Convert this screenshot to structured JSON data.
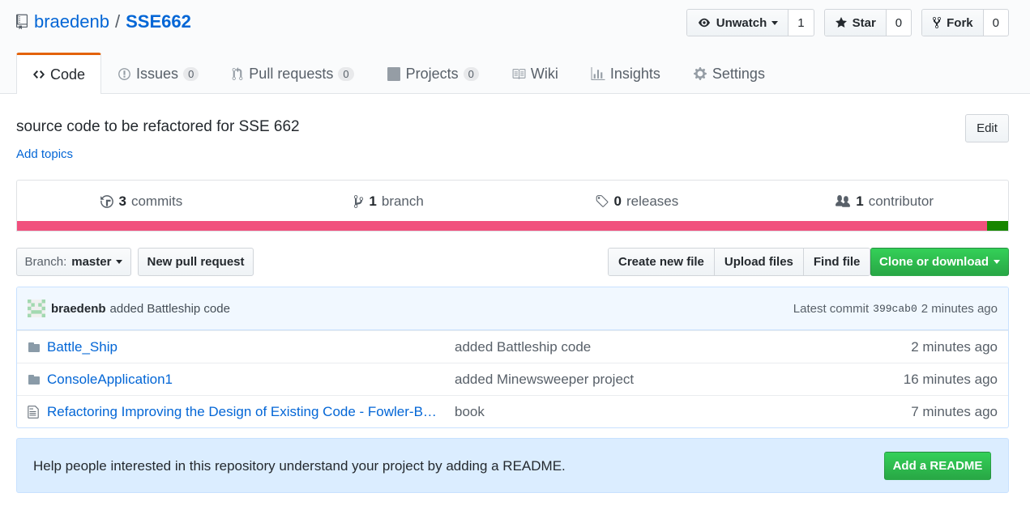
{
  "repo": {
    "owner": "braedenb",
    "separator": "/",
    "name": "SSE662"
  },
  "actions": {
    "watch": {
      "label": "Unwatch",
      "count": "1"
    },
    "star": {
      "label": "Star",
      "count": "0"
    },
    "fork": {
      "label": "Fork",
      "count": "0"
    }
  },
  "tabs": [
    {
      "label": "Code",
      "icon": "code-icon"
    },
    {
      "label": "Issues",
      "counter": "0",
      "icon": "issue-icon"
    },
    {
      "label": "Pull requests",
      "counter": "0",
      "icon": "pull-request-icon"
    },
    {
      "label": "Projects",
      "counter": "0",
      "icon": "project-icon"
    },
    {
      "label": "Wiki",
      "icon": "book-icon"
    },
    {
      "label": "Insights",
      "icon": "graph-icon"
    },
    {
      "label": "Settings",
      "icon": "gear-icon"
    }
  ],
  "description": "source code to be refactored for SSE 662",
  "add_topics": "Add topics",
  "edit_label": "Edit",
  "summary": {
    "commits": {
      "num": "3",
      "label": "commits"
    },
    "branches": {
      "num": "1",
      "label": "branch"
    },
    "releases": {
      "num": "0",
      "label": "releases"
    },
    "contributors": {
      "num": "1",
      "label": "contributor"
    }
  },
  "language_bar": [
    {
      "color": "#f1507d",
      "fraction": 0.979
    },
    {
      "color": "#178600",
      "fraction": 0.021
    }
  ],
  "branch": {
    "label": "Branch:",
    "value": "master"
  },
  "new_pr_label": "New pull request",
  "file_buttons": [
    "Create new file",
    "Upload files",
    "Find file"
  ],
  "clone_label": "Clone or download",
  "commit_tease": {
    "author": "braedenb",
    "message": "added Battleship code",
    "latest_label": "Latest commit",
    "sha": "399cab0",
    "age": "2 minutes ago"
  },
  "files": [
    {
      "type": "folder",
      "name": "Battle_Ship",
      "message": "added Battleship code",
      "age": "2 minutes ago"
    },
    {
      "type": "folder",
      "name": "ConsoleApplication1",
      "message": "added Minewsweeper project",
      "age": "16 minutes ago"
    },
    {
      "type": "file",
      "name": "Refactoring Improving the Design of Existing Code - Fowler-B…",
      "message": "book",
      "age": "7 minutes ago"
    }
  ],
  "readme_prompt": {
    "text": "Help people interested in this repository understand your project by adding a README.",
    "button": "Add a README"
  },
  "colors": {
    "link": "#0366d6",
    "accent_tab": "#e36209",
    "primary_button": "#28a745"
  }
}
